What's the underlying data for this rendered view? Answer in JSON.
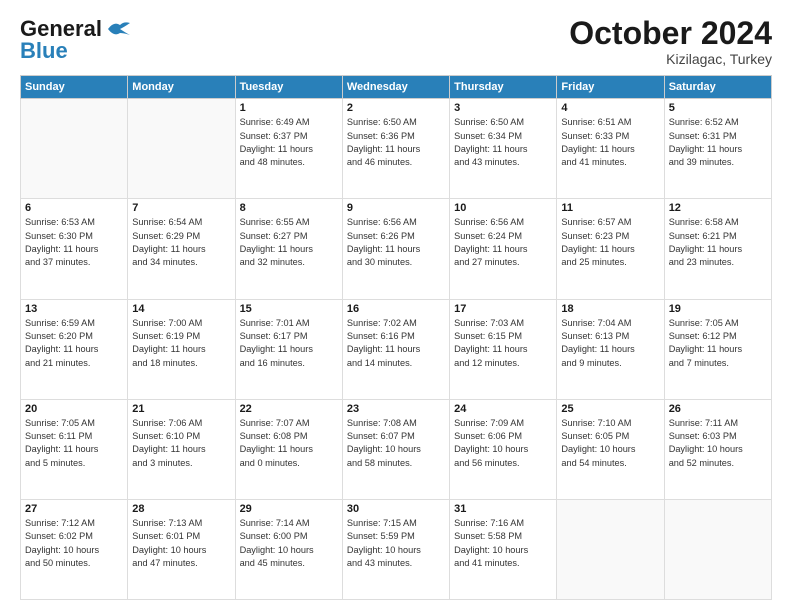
{
  "header": {
    "logo_general": "General",
    "logo_blue": "Blue",
    "month": "October 2024",
    "location": "Kizilagac, Turkey"
  },
  "days_of_week": [
    "Sunday",
    "Monday",
    "Tuesday",
    "Wednesday",
    "Thursday",
    "Friday",
    "Saturday"
  ],
  "weeks": [
    [
      {
        "day": "",
        "info": ""
      },
      {
        "day": "",
        "info": ""
      },
      {
        "day": "1",
        "info": "Sunrise: 6:49 AM\nSunset: 6:37 PM\nDaylight: 11 hours\nand 48 minutes."
      },
      {
        "day": "2",
        "info": "Sunrise: 6:50 AM\nSunset: 6:36 PM\nDaylight: 11 hours\nand 46 minutes."
      },
      {
        "day": "3",
        "info": "Sunrise: 6:50 AM\nSunset: 6:34 PM\nDaylight: 11 hours\nand 43 minutes."
      },
      {
        "day": "4",
        "info": "Sunrise: 6:51 AM\nSunset: 6:33 PM\nDaylight: 11 hours\nand 41 minutes."
      },
      {
        "day": "5",
        "info": "Sunrise: 6:52 AM\nSunset: 6:31 PM\nDaylight: 11 hours\nand 39 minutes."
      }
    ],
    [
      {
        "day": "6",
        "info": "Sunrise: 6:53 AM\nSunset: 6:30 PM\nDaylight: 11 hours\nand 37 minutes."
      },
      {
        "day": "7",
        "info": "Sunrise: 6:54 AM\nSunset: 6:29 PM\nDaylight: 11 hours\nand 34 minutes."
      },
      {
        "day": "8",
        "info": "Sunrise: 6:55 AM\nSunset: 6:27 PM\nDaylight: 11 hours\nand 32 minutes."
      },
      {
        "day": "9",
        "info": "Sunrise: 6:56 AM\nSunset: 6:26 PM\nDaylight: 11 hours\nand 30 minutes."
      },
      {
        "day": "10",
        "info": "Sunrise: 6:56 AM\nSunset: 6:24 PM\nDaylight: 11 hours\nand 27 minutes."
      },
      {
        "day": "11",
        "info": "Sunrise: 6:57 AM\nSunset: 6:23 PM\nDaylight: 11 hours\nand 25 minutes."
      },
      {
        "day": "12",
        "info": "Sunrise: 6:58 AM\nSunset: 6:21 PM\nDaylight: 11 hours\nand 23 minutes."
      }
    ],
    [
      {
        "day": "13",
        "info": "Sunrise: 6:59 AM\nSunset: 6:20 PM\nDaylight: 11 hours\nand 21 minutes."
      },
      {
        "day": "14",
        "info": "Sunrise: 7:00 AM\nSunset: 6:19 PM\nDaylight: 11 hours\nand 18 minutes."
      },
      {
        "day": "15",
        "info": "Sunrise: 7:01 AM\nSunset: 6:17 PM\nDaylight: 11 hours\nand 16 minutes."
      },
      {
        "day": "16",
        "info": "Sunrise: 7:02 AM\nSunset: 6:16 PM\nDaylight: 11 hours\nand 14 minutes."
      },
      {
        "day": "17",
        "info": "Sunrise: 7:03 AM\nSunset: 6:15 PM\nDaylight: 11 hours\nand 12 minutes."
      },
      {
        "day": "18",
        "info": "Sunrise: 7:04 AM\nSunset: 6:13 PM\nDaylight: 11 hours\nand 9 minutes."
      },
      {
        "day": "19",
        "info": "Sunrise: 7:05 AM\nSunset: 6:12 PM\nDaylight: 11 hours\nand 7 minutes."
      }
    ],
    [
      {
        "day": "20",
        "info": "Sunrise: 7:05 AM\nSunset: 6:11 PM\nDaylight: 11 hours\nand 5 minutes."
      },
      {
        "day": "21",
        "info": "Sunrise: 7:06 AM\nSunset: 6:10 PM\nDaylight: 11 hours\nand 3 minutes."
      },
      {
        "day": "22",
        "info": "Sunrise: 7:07 AM\nSunset: 6:08 PM\nDaylight: 11 hours\nand 0 minutes."
      },
      {
        "day": "23",
        "info": "Sunrise: 7:08 AM\nSunset: 6:07 PM\nDaylight: 10 hours\nand 58 minutes."
      },
      {
        "day": "24",
        "info": "Sunrise: 7:09 AM\nSunset: 6:06 PM\nDaylight: 10 hours\nand 56 minutes."
      },
      {
        "day": "25",
        "info": "Sunrise: 7:10 AM\nSunset: 6:05 PM\nDaylight: 10 hours\nand 54 minutes."
      },
      {
        "day": "26",
        "info": "Sunrise: 7:11 AM\nSunset: 6:03 PM\nDaylight: 10 hours\nand 52 minutes."
      }
    ],
    [
      {
        "day": "27",
        "info": "Sunrise: 7:12 AM\nSunset: 6:02 PM\nDaylight: 10 hours\nand 50 minutes."
      },
      {
        "day": "28",
        "info": "Sunrise: 7:13 AM\nSunset: 6:01 PM\nDaylight: 10 hours\nand 47 minutes."
      },
      {
        "day": "29",
        "info": "Sunrise: 7:14 AM\nSunset: 6:00 PM\nDaylight: 10 hours\nand 45 minutes."
      },
      {
        "day": "30",
        "info": "Sunrise: 7:15 AM\nSunset: 5:59 PM\nDaylight: 10 hours\nand 43 minutes."
      },
      {
        "day": "31",
        "info": "Sunrise: 7:16 AM\nSunset: 5:58 PM\nDaylight: 10 hours\nand 41 minutes."
      },
      {
        "day": "",
        "info": ""
      },
      {
        "day": "",
        "info": ""
      }
    ]
  ]
}
